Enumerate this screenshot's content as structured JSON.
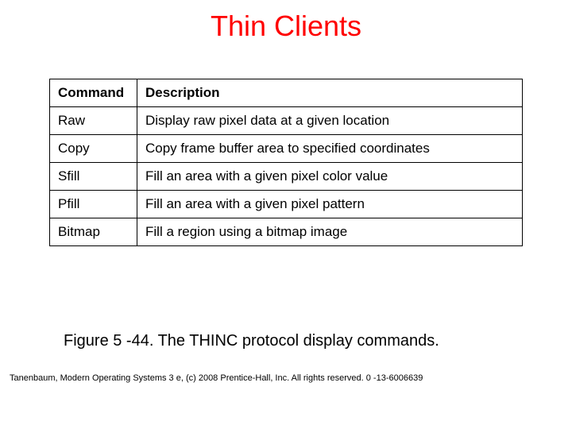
{
  "title": "Thin Clients",
  "table": {
    "headers": {
      "command": "Command",
      "description": "Description"
    },
    "rows": [
      {
        "command": "Raw",
        "description": "Display raw pixel data at a given location"
      },
      {
        "command": "Copy",
        "description": "Copy frame buffer area to specified coordinates"
      },
      {
        "command": "Sfill",
        "description": "Fill an area with a given pixel color value"
      },
      {
        "command": "Pfill",
        "description": "Fill an area with a given pixel pattern"
      },
      {
        "command": "Bitmap",
        "description": "Fill a region using a bitmap image"
      }
    ]
  },
  "caption": "Figure 5 -44. The THINC protocol display commands.",
  "footer": "Tanenbaum, Modern Operating Systems 3 e, (c) 2008 Prentice-Hall, Inc. All rights reserved. 0 -13-6006639"
}
